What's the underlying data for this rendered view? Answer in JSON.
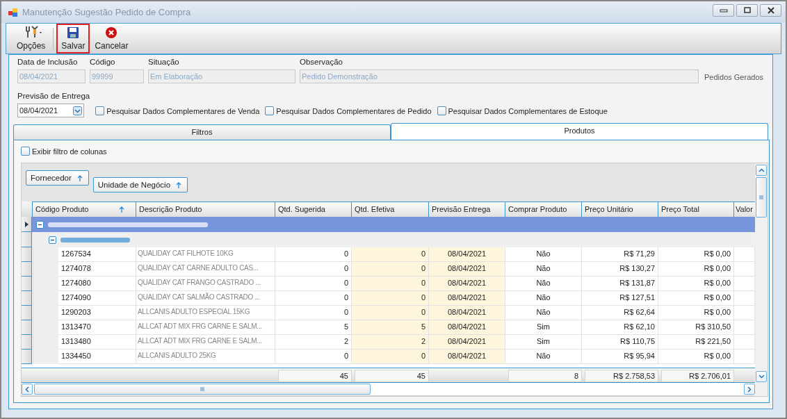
{
  "window": {
    "title": "Manutenção Sugestão Pedido de Compra"
  },
  "toolbar": [
    {
      "kind": "options",
      "label": "Opções",
      "focused": false
    },
    {
      "kind": "save",
      "label": "Salvar",
      "focused": true
    },
    {
      "kind": "cancel",
      "label": "Cancelar",
      "focused": false
    }
  ],
  "form": {
    "fields": [
      {
        "label": "Data de Inclusão",
        "value": "08/04/2021"
      },
      {
        "label": "Código",
        "value": "99999"
      },
      {
        "label": "Situação",
        "value": "Em Elaboração"
      },
      {
        "label": "Observação",
        "value": "Pedido Demonstração"
      }
    ],
    "side_label": "Pedidos Gerados",
    "delivery": {
      "label": "Previsão de Entrega",
      "value": "08/04/2021"
    },
    "checkboxes": [
      {
        "label": "Pesquisar Dados Complementares de Venda",
        "checked": false
      },
      {
        "label": "Pesquisar Dados Complementares de Pedido",
        "checked": false
      },
      {
        "label": "Pesquisar Dados Complementares de Estoque",
        "checked": false
      }
    ]
  },
  "tabs": [
    {
      "label": "Filtros",
      "selected": false
    },
    {
      "label": "Produtos",
      "selected": true
    }
  ],
  "grid": {
    "column_filter": {
      "label": "Exibir filtro de colunas",
      "checked": false
    },
    "group_by": [
      {
        "label": "Fornecedor"
      },
      {
        "label": "Unidade de Negócio"
      }
    ],
    "columns": [
      {
        "label": "Código Produto",
        "sorted": true
      },
      {
        "label": "Descrição Produto",
        "sorted": false
      },
      {
        "label": "Qtd. Sugerida",
        "sorted": false
      },
      {
        "label": "Qtd. Efetiva",
        "sorted": false
      },
      {
        "label": "Previsão Entrega",
        "sorted": false
      },
      {
        "label": "Comprar Produto",
        "sorted": false
      },
      {
        "label": "Preço Unitário",
        "sorted": false
      },
      {
        "label": "Preço Total",
        "sorted": false
      },
      {
        "label": "Valor",
        "sorted": false
      }
    ],
    "groups": [
      {
        "current": true,
        "expanded": true
      },
      {
        "current": false,
        "expanded": true
      }
    ],
    "rows": [
      [
        "1267534",
        "QUALIDAY CAT FILHOTE 10KG",
        "0",
        "0",
        "08/04/2021",
        "Não",
        "R$ 71,29",
        "R$ 0,00"
      ],
      [
        "1274078",
        "QUALIDAY CAT CARNE ADULTO CAS...",
        "0",
        "0",
        "08/04/2021",
        "Não",
        "R$ 130,27",
        "R$ 0,00"
      ],
      [
        "1274080",
        "QUALIDAY CAT FRANGO CASTRADO ...",
        "0",
        "0",
        "08/04/2021",
        "Não",
        "R$ 131,87",
        "R$ 0,00"
      ],
      [
        "1274090",
        "QUALIDAY CAT SALMÃO CASTRADO ...",
        "0",
        "0",
        "08/04/2021",
        "Não",
        "R$ 127,51",
        "R$ 0,00"
      ],
      [
        "1290203",
        "ALLCANIS ADULTO ESPECIAL 15KG",
        "0",
        "0",
        "08/04/2021",
        "Não",
        "R$ 62,64",
        "R$ 0,00"
      ],
      [
        "1313470",
        "ALLCAT ADT MIX FRG CARNE E SALM...",
        "5",
        "5",
        "08/04/2021",
        "Sim",
        "R$ 62,10",
        "R$ 310,50"
      ],
      [
        "1313480",
        "ALLCAT ADT MIX FRG CARNE E SALM...",
        "2",
        "2",
        "08/04/2021",
        "Sim",
        "R$ 110,75",
        "R$ 221,50"
      ],
      [
        "1334450",
        "ALLCANIS ADULTO 25KG",
        "0",
        "0",
        "08/04/2021",
        "Não",
        "R$ 95,94",
        "R$ 0,00"
      ]
    ],
    "totals": {
      "qtd_sugerida": "45",
      "qtd_efetiva": "45",
      "comprar": "8",
      "preco_unitario": "R$ 2.758,53",
      "preco_total": "R$ 2.706,01"
    }
  }
}
